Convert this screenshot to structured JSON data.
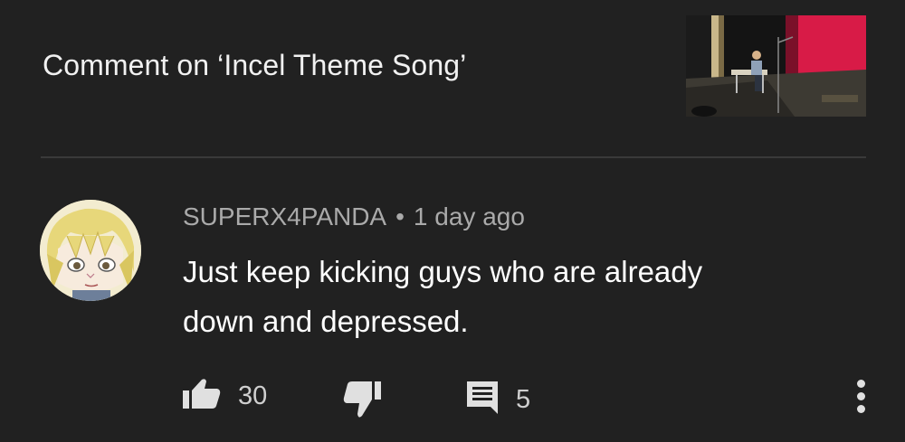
{
  "header": {
    "title": "Comment on ‘Incel Theme Song’"
  },
  "comment": {
    "author": "SUPERX4PANDA",
    "separator": "•",
    "time": "1 day ago",
    "text_line1": "Just keep kicking guys who are already",
    "text_line2": "down and depressed."
  },
  "actions": {
    "like_count": "30",
    "reply_count": "5"
  },
  "icons": {
    "like": "thumbs-up-icon",
    "dislike": "thumbs-down-icon",
    "reply": "comment-icon",
    "more": "more-vertical-icon"
  },
  "colors": {
    "background": "#212121",
    "text": "#ffffff",
    "meta": "#aaaaaa",
    "divider": "#3a3a3a"
  }
}
